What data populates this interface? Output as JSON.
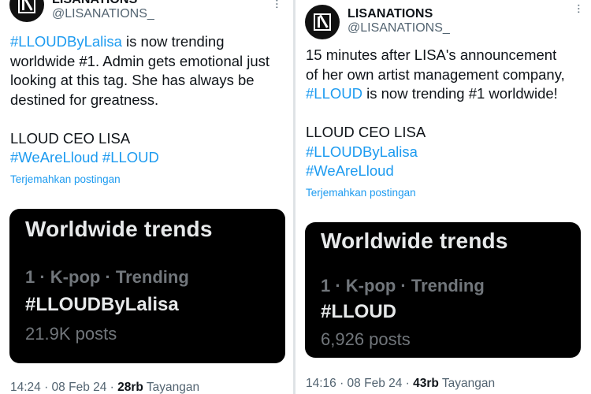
{
  "left": {
    "account_name": "LISANATIONS",
    "handle": "@LISANATIONS_",
    "text_lines": [
      {
        "tag": "#LLOUDByLalisa",
        "rest": " is now trending"
      },
      {
        "text": "worldwide #1. Admin gets emotional just"
      },
      {
        "text": "looking at this tag. She has always be"
      },
      {
        "text": "destined for greatness."
      },
      {
        "text": "LLOUD CEO LISA"
      },
      {
        "tags": "#WeAreLloud #LLOUD"
      }
    ],
    "translate_label": "Terjemahkan postingan",
    "card": {
      "title": "Worldwide trends",
      "rank_line": "1 · K-pop · Trending",
      "trend": "#LLOUDByLalisa",
      "posts": "21.9K posts"
    },
    "meta": {
      "time": "14:24 · 08 Feb 24 · ",
      "views": "28rb",
      "views_label": " Tayangan"
    }
  },
  "right": {
    "account_name": "LISANATIONS",
    "handle": "@LISANATIONS_",
    "text_lines": [
      {
        "text": "15 minutes after LISA's announcement"
      },
      {
        "text": "of her own artist management company,"
      },
      {
        "tag": "#LLOUD",
        "rest": " is now trending #1 worldwide!"
      },
      {
        "text": "LLOUD CEO LISA"
      },
      {
        "tags": "#LLOUDByLalisa"
      },
      {
        "tags": "#WeAreLloud"
      }
    ],
    "translate_label": "Terjemahkan postingan",
    "card": {
      "title": "Worldwide trends",
      "rank_line": "1 · K-pop · Trending",
      "trend": "#LLOUD",
      "posts": "6,926 posts"
    },
    "meta": {
      "time": "14:16 · 08 Feb 24 · ",
      "views": "43rb",
      "views_label": " Tayangan"
    }
  },
  "more_glyph": "···",
  "colors": {
    "link": "#1d9bf0",
    "text": "#0f1419",
    "muted": "#536471",
    "card_bg": "#000000"
  }
}
